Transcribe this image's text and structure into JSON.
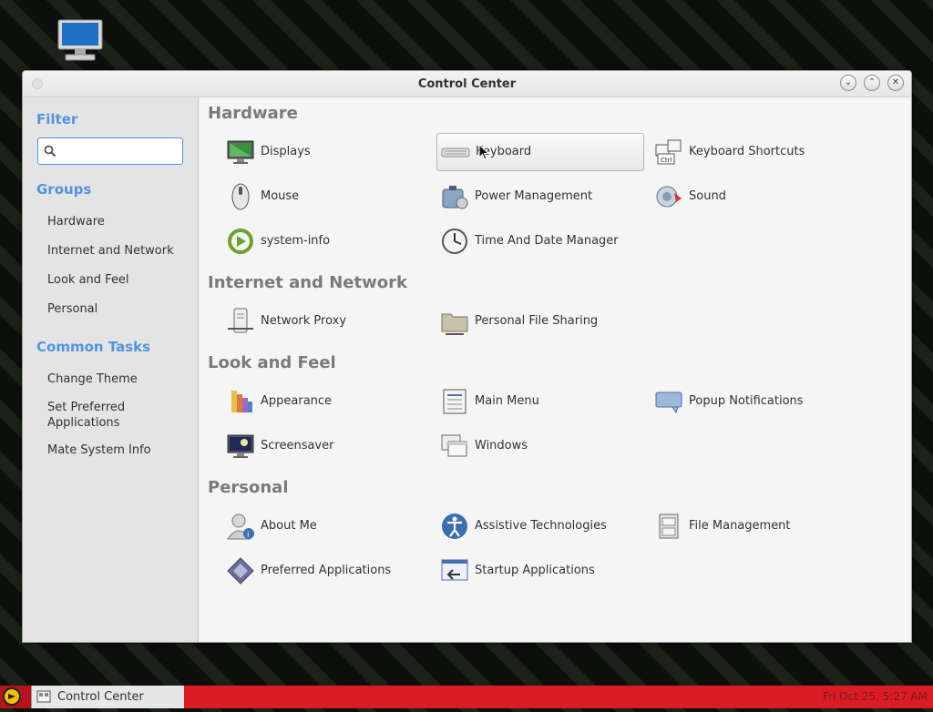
{
  "window": {
    "title": "Control Center"
  },
  "sidebar": {
    "filter_heading": "Filter",
    "filter_placeholder": "",
    "groups_heading": "Groups",
    "groups": [
      "Hardware",
      "Internet and Network",
      "Look and Feel",
      "Personal"
    ],
    "tasks_heading": "Common Tasks",
    "tasks": [
      "Change Theme",
      "Set Preferred Applications",
      "Mate System Info"
    ]
  },
  "sections": [
    {
      "title": "Hardware",
      "items": [
        {
          "label": "Displays",
          "icon": "display-icon"
        },
        {
          "label": "Keyboard",
          "icon": "keyboard-icon",
          "selected": true
        },
        {
          "label": "Keyboard Shortcuts",
          "icon": "keyboard-shortcuts-icon"
        },
        {
          "label": "Mouse",
          "icon": "mouse-icon"
        },
        {
          "label": "Power Management",
          "icon": "power-management-icon"
        },
        {
          "label": "Sound",
          "icon": "sound-icon"
        },
        {
          "label": "system-info",
          "icon": "system-info-icon"
        },
        {
          "label": "Time And Date Manager",
          "icon": "clock-icon"
        }
      ]
    },
    {
      "title": "Internet and Network",
      "items": [
        {
          "label": "Network Proxy",
          "icon": "network-proxy-icon"
        },
        {
          "label": "Personal File Sharing",
          "icon": "folder-share-icon"
        }
      ]
    },
    {
      "title": "Look and Feel",
      "items": [
        {
          "label": "Appearance",
          "icon": "appearance-icon"
        },
        {
          "label": "Main Menu",
          "icon": "main-menu-icon"
        },
        {
          "label": "Popup Notifications",
          "icon": "popup-notifications-icon"
        },
        {
          "label": "Screensaver",
          "icon": "screensaver-icon"
        },
        {
          "label": "Windows",
          "icon": "windows-icon"
        }
      ]
    },
    {
      "title": "Personal",
      "items": [
        {
          "label": "About Me",
          "icon": "about-me-icon"
        },
        {
          "label": "Assistive Technologies",
          "icon": "accessibility-icon"
        },
        {
          "label": "File Management",
          "icon": "file-management-icon"
        },
        {
          "label": "Preferred Applications",
          "icon": "preferred-apps-icon"
        },
        {
          "label": "Startup Applications",
          "icon": "startup-apps-icon"
        }
      ]
    }
  ],
  "taskbar": {
    "task_label": "Control Center",
    "clock": "Fri Oct 25,  5:27 AM",
    "accent": "#dc1c24"
  }
}
